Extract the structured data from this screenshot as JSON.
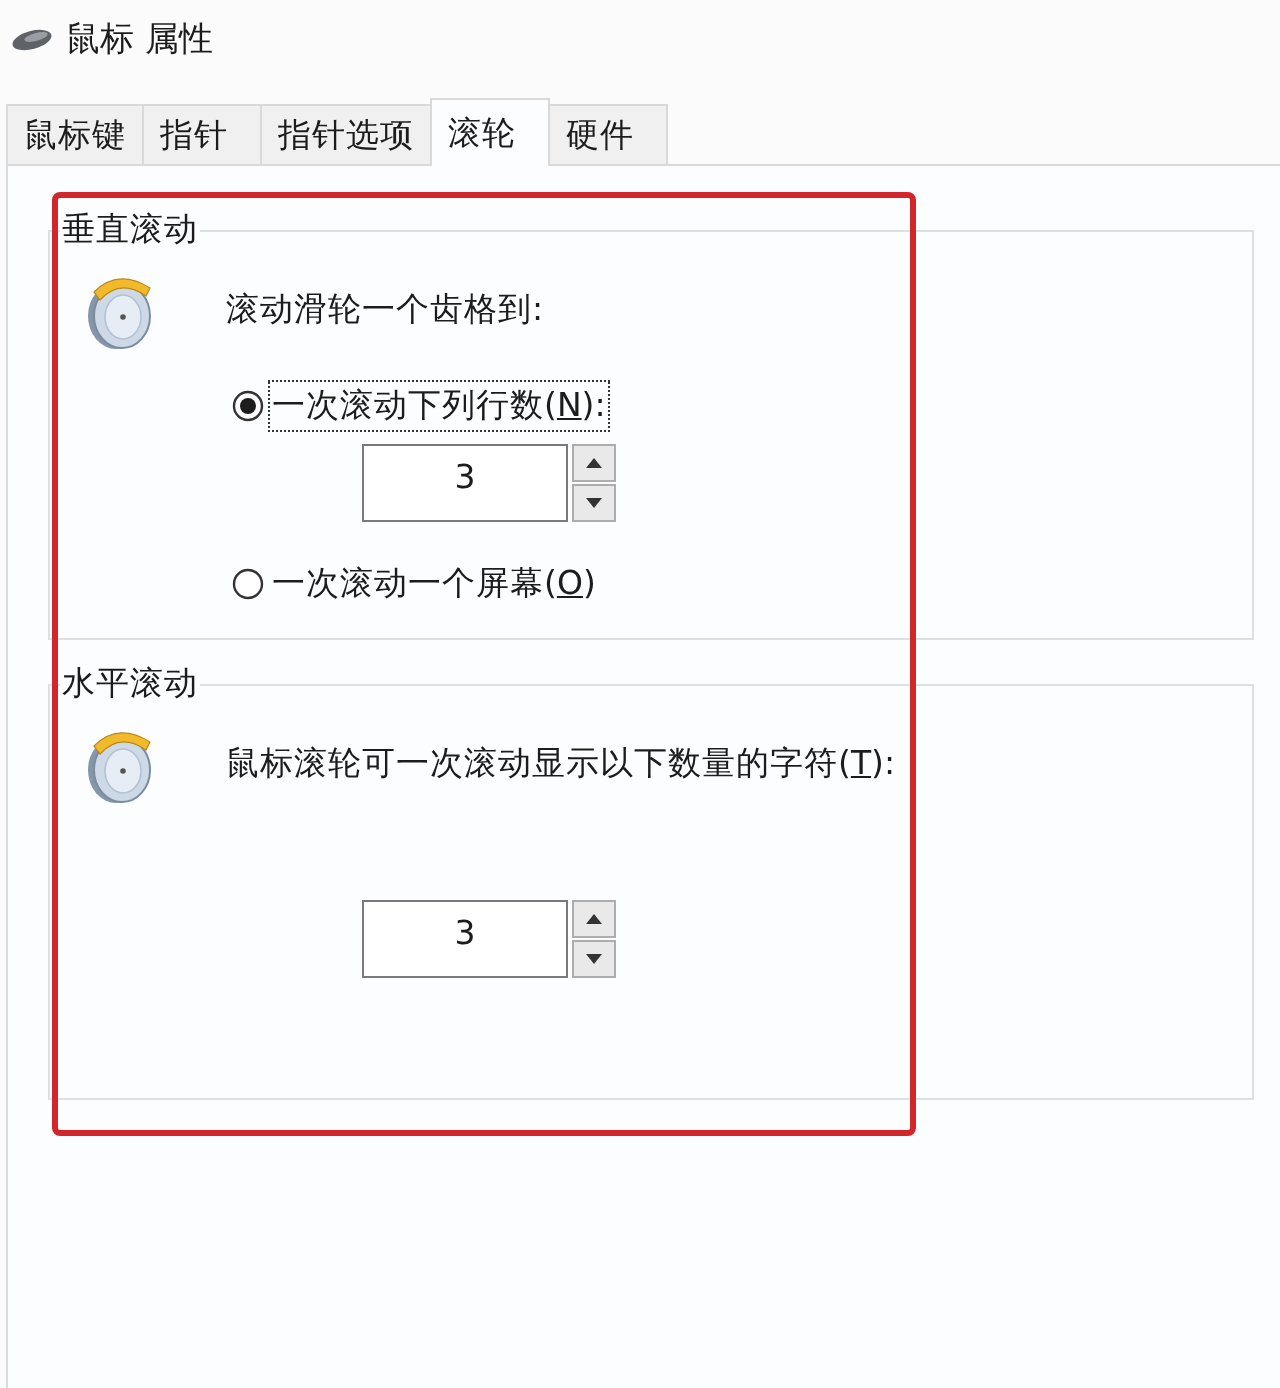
{
  "window": {
    "title": "鼠标 属性"
  },
  "tabs": [
    {
      "label": "鼠标键",
      "selected": false
    },
    {
      "label": "指针",
      "selected": false
    },
    {
      "label": "指针选项",
      "selected": false
    },
    {
      "label": "滚轮",
      "selected": true
    },
    {
      "label": "硬件",
      "selected": false
    }
  ],
  "groups": [
    {
      "title": "垂直滚动",
      "prompt": "滚动滑轮一个齿格到:",
      "options": [
        {
          "kind": "radio",
          "label": "一次滚动下列行数(",
          "access_key": "N",
          "label_tail": "):",
          "selected": true,
          "focused": true
        },
        {
          "kind": "spinner",
          "value": "3"
        },
        {
          "kind": "radio",
          "label": "一次滚动一个屏幕(",
          "access_key": "O",
          "label_tail": ")",
          "selected": false,
          "focused": false
        }
      ]
    },
    {
      "title": "水平滚动",
      "prompt": "鼠标滚轮可一次滚动显示以下数量的字符(",
      "prompt_key": "T",
      "prompt_tail": "):",
      "options": [
        {
          "kind": "spinner",
          "value": "3"
        }
      ]
    }
  ],
  "annotation": {
    "kind": "frame"
  }
}
